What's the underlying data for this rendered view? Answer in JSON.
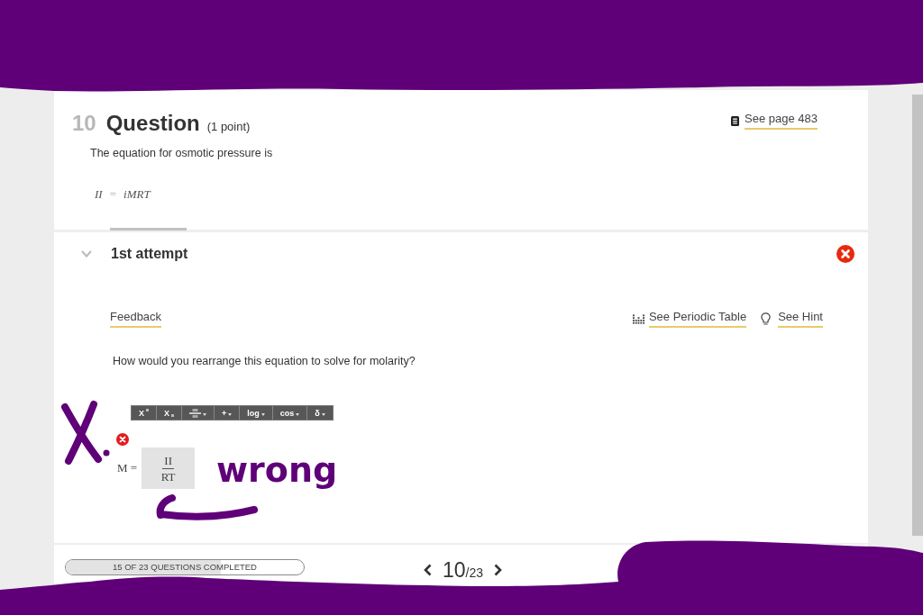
{
  "question": {
    "number": "10",
    "title": "Question",
    "points": "(1 point)",
    "reference_link": "See page 483",
    "prompt": "The equation for osmotic pressure is",
    "equation": {
      "lhs": "II",
      "operator": "=",
      "rhs": "iMRT"
    }
  },
  "attempt": {
    "title": "1st attempt",
    "expanded": true,
    "correct": false,
    "feedback_link": "Feedback",
    "tools": [
      {
        "kind": "periodic_table",
        "label": "See Periodic Table"
      },
      {
        "kind": "hint",
        "label": "See Hint"
      }
    ],
    "prompt": "How would you rearrange this equation to solve for molarity?",
    "toolbar": [
      {
        "kind": "superscript",
        "label": "X",
        "dropdown": false
      },
      {
        "kind": "subscript",
        "label": "X",
        "dropdown": false
      },
      {
        "kind": "fraction",
        "dropdown": true
      },
      {
        "kind": "text",
        "label": "+",
        "dropdown": true
      },
      {
        "kind": "text",
        "label": "log",
        "dropdown": true
      },
      {
        "kind": "text",
        "label": "cos",
        "dropdown": true
      },
      {
        "kind": "text",
        "label": "δ",
        "dropdown": true
      }
    ],
    "answer": {
      "correct": false,
      "variable": "M =",
      "numerator": "II",
      "denominator": "RT"
    }
  },
  "footer": {
    "progress": {
      "label": "15 OF 23 QUESTIONS COMPLETED",
      "level": 0.65
    },
    "pagination": {
      "current": "10",
      "total": "/23"
    }
  },
  "annotations": [
    {
      "kind": "scribble_top"
    },
    {
      "kind": "cross"
    },
    {
      "kind": "text",
      "text": "wrong"
    },
    {
      "kind": "arrow"
    },
    {
      "kind": "scribble_bottom"
    }
  ]
}
